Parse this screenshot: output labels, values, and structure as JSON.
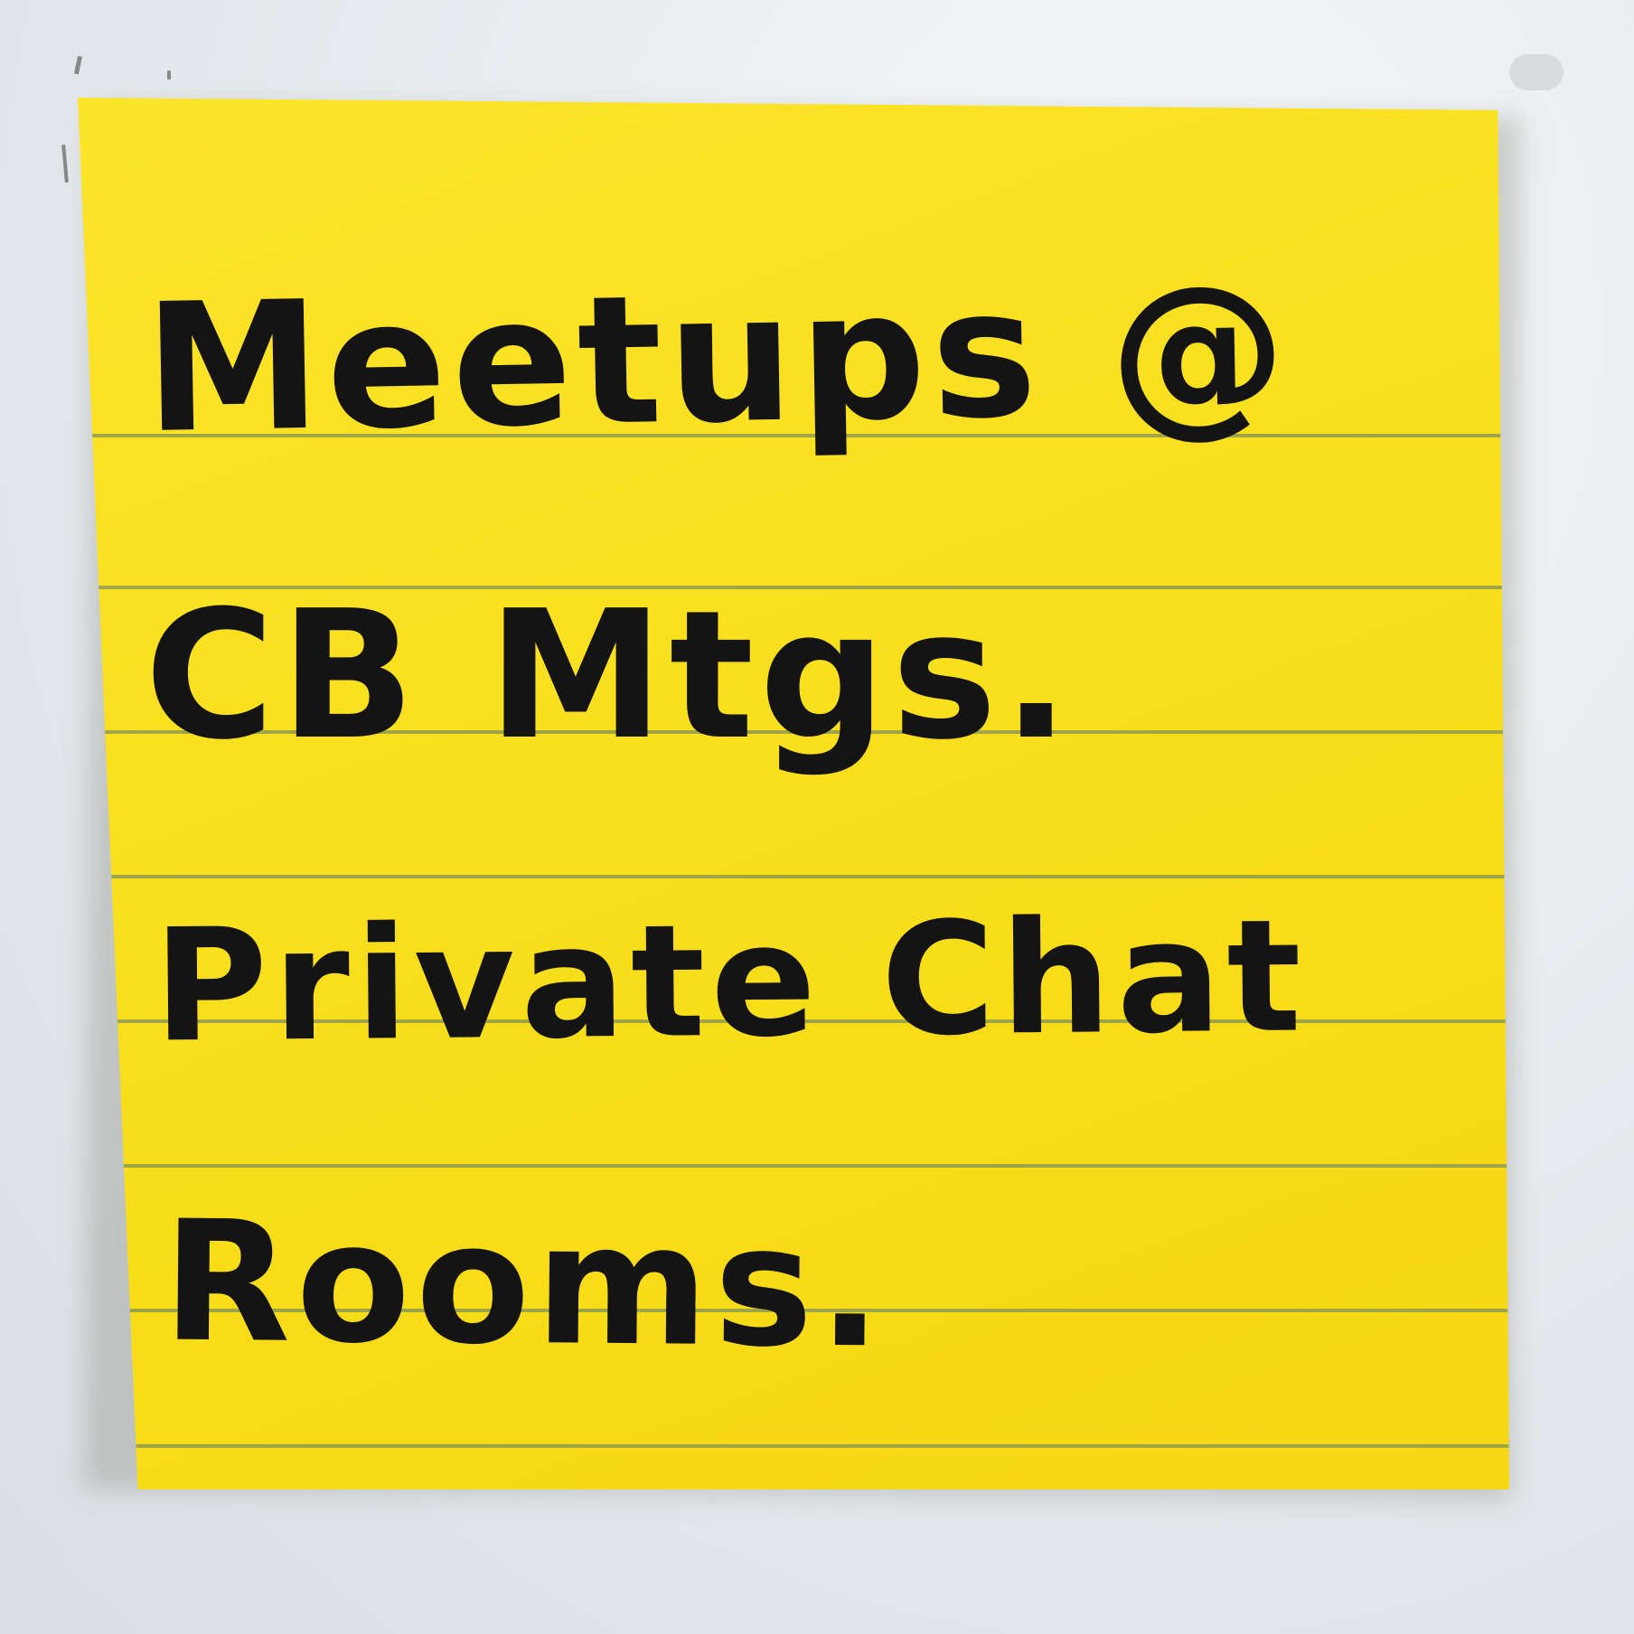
{
  "image": {
    "subject": "sticky-note",
    "note_color": "#f9df1c",
    "line_color": "#8f9a4e",
    "ink_color": "#141414",
    "background_color": "#e6e9ed"
  },
  "note": {
    "lines": [
      "Meetups @",
      "CB Mtgs.",
      "Private Chat",
      "Rooms."
    ]
  }
}
